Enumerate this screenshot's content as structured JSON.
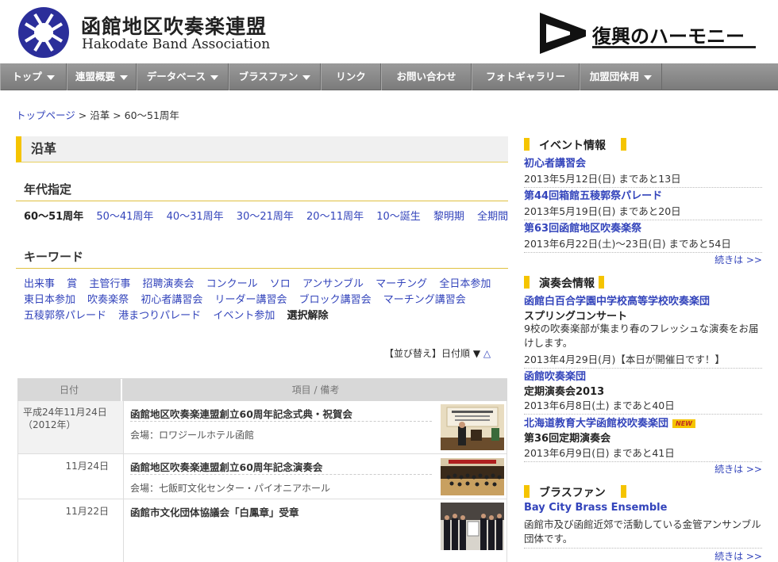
{
  "header": {
    "site_title": "函館地区吹奏楽連盟",
    "site_subtitle": "Hakodate Band Association",
    "banner_text": "復興のハーモニー"
  },
  "nav": {
    "items": [
      {
        "label": "トップ",
        "dropdown": true
      },
      {
        "label": "連盟概要",
        "dropdown": true
      },
      {
        "label": "データベース",
        "dropdown": true
      },
      {
        "label": "ブラスファン",
        "dropdown": true
      },
      {
        "label": "リンク",
        "dropdown": false
      },
      {
        "label": "お問い合わせ",
        "dropdown": false
      },
      {
        "label": "フォトギャラリー",
        "dropdown": false
      },
      {
        "label": "加盟団体用",
        "dropdown": true
      }
    ]
  },
  "breadcrumb": {
    "top": "トップページ",
    "sep": " > ",
    "history": "沿革",
    "current": "60〜51周年"
  },
  "page_title": "沿革",
  "era": {
    "heading": "年代指定",
    "items": [
      "60〜51周年",
      "50〜41周年",
      "40〜31周年",
      "30〜21周年",
      "20〜11周年",
      "10〜誕生",
      "黎明期",
      "全期間"
    ]
  },
  "keyword": {
    "heading": "キーワード",
    "row1": [
      "出来事",
      "賞",
      "主管行事",
      "招聘演奏会",
      "コンクール",
      "ソロ",
      "アンサンブル",
      "マーチング",
      "全日本参加"
    ],
    "row2": [
      "東日本参加",
      "吹奏楽祭",
      "初心者講習会",
      "リーダー講習会",
      "ブロック講習会",
      "マーチング講習会"
    ],
    "row3": [
      "五稜郭祭パレード",
      "港まつりパレード",
      "イベント参加"
    ],
    "clear": "選択解除"
  },
  "sort": {
    "label": "【並び替え】日付順",
    "desc": "▼",
    "asc": "△"
  },
  "table": {
    "col_date": "日付",
    "col_item": "項目 / 備考",
    "rows": [
      {
        "date": "平成24年11月24日（2012年）",
        "title": "函館地区吹奏楽連盟創立60周年記念式典・祝賀会",
        "venue": "会場：ロワジールホテル函館"
      },
      {
        "date": "11月24日",
        "title": "函館地区吹奏楽連盟創立60周年記念演奏会",
        "venue": "会場：七飯町文化センター・パイオニアホール"
      },
      {
        "date": "11月22日",
        "title": "函館市文化団体協議会「白鳳章」受章",
        "venue": ""
      }
    ]
  },
  "sidebar": {
    "events": {
      "heading": "イベント情報",
      "items": [
        {
          "title": "初心者講習会",
          "date": "2013年5月12日(日) まであと13日"
        },
        {
          "title": "第44回箱館五稜郭祭パレード",
          "date": "2013年5月19日(日) まであと20日"
        },
        {
          "title": "第63回函館地区吹奏楽祭",
          "date": "2013年6月22日(土)〜23日(日) まであと54日"
        }
      ],
      "more": "続きは >>"
    },
    "concerts": {
      "heading": "演奏会情報",
      "items": [
        {
          "title": "函館白百合学園中学校高等学校吹奏楽団",
          "sub": "スプリングコンサート",
          "desc": "9校の吹奏楽部が集まり春のフレッシュな演奏をお届けします。",
          "date": "2013年4月29日(月)【本日が開催日です！】"
        },
        {
          "title": "函館吹奏楽団",
          "sub": "定期演奏会2013",
          "desc": "",
          "date": "2013年6月8日(土) まであと40日"
        },
        {
          "title": "北海道教育大学函館校吹奏楽団",
          "badge": "NEW",
          "sub": "第36回定期演奏会",
          "desc": "",
          "date": "2013年6月9日(日) まであと41日"
        }
      ],
      "more": "続きは >>"
    },
    "brassfan": {
      "heading": "ブラスファン",
      "title": "Bay City Brass Ensemble",
      "desc": "函館市及び函館近郊で活動している金管アンサンブル団体です。",
      "more": "続きは >>"
    }
  },
  "colors": {
    "accent": "#f5c400",
    "link": "#3344bb",
    "nav_bg": "#8a8a8a"
  }
}
